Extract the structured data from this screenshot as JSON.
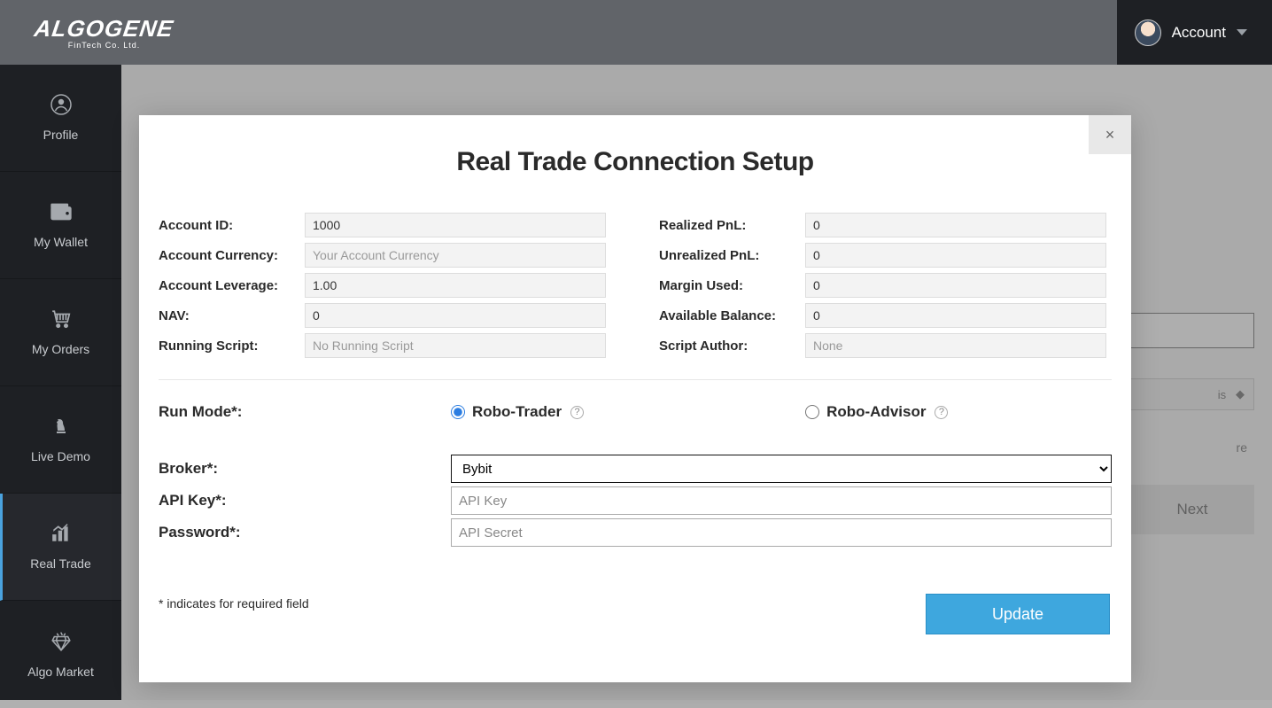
{
  "header": {
    "logo_main": "ALGOGENE",
    "logo_sub": "FinTech Co. Ltd.",
    "account_label": "Account"
  },
  "sidebar": {
    "items": [
      {
        "label": "Profile"
      },
      {
        "label": "My Wallet"
      },
      {
        "label": "My Orders"
      },
      {
        "label": "Live Demo"
      },
      {
        "label": "Real Trade"
      },
      {
        "label": "Algo Market"
      }
    ]
  },
  "background_peek": {
    "select_suffix": "is",
    "text_fragment": "re",
    "next_label": "Next"
  },
  "modal": {
    "title": "Real Trade Connection Setup",
    "close_glyph": "×",
    "fields_left": {
      "account_id": {
        "label": "Account ID:",
        "value": "1000"
      },
      "account_currency": {
        "label": "Account Currency:",
        "placeholder": "Your Account Currency",
        "value": ""
      },
      "account_leverage": {
        "label": "Account Leverage:",
        "value": "1.00"
      },
      "nav": {
        "label": "NAV:",
        "value": "0"
      },
      "running_script": {
        "label": "Running Script:",
        "placeholder": "No Running Script",
        "value": ""
      }
    },
    "fields_right": {
      "realized_pnl": {
        "label": "Realized PnL:",
        "value": "0"
      },
      "unrealized_pnl": {
        "label": "Unrealized PnL:",
        "value": "0"
      },
      "margin_used": {
        "label": "Margin Used:",
        "value": "0"
      },
      "available_balance": {
        "label": "Available Balance:",
        "value": "0"
      },
      "script_author": {
        "label": "Script Author:",
        "placeholder": "None",
        "value": ""
      }
    },
    "run_mode": {
      "label": "Run Mode*:",
      "options": {
        "robo_trader": "Robo-Trader",
        "robo_advisor": "Robo-Advisor"
      },
      "selected": "robo_trader"
    },
    "broker": {
      "label": "Broker*:",
      "selected": "Bybit"
    },
    "api_key": {
      "label": "API Key*:",
      "placeholder": "API Key",
      "value": ""
    },
    "password": {
      "label": "Password*:",
      "placeholder": "API Secret",
      "value": ""
    },
    "required_note": "* indicates for required field",
    "update_button": "Update"
  }
}
